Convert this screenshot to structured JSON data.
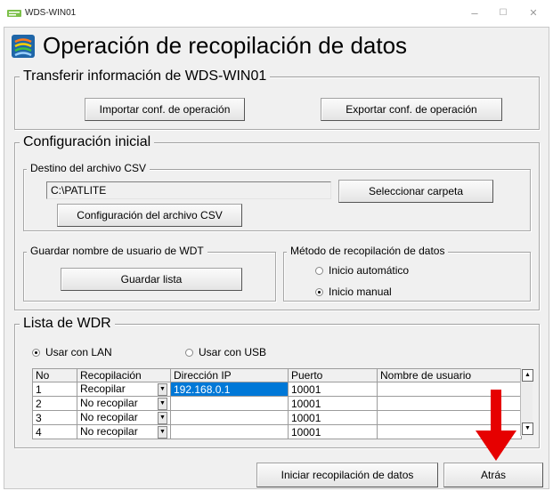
{
  "window": {
    "title": "WDS-WIN01",
    "minimize": "–",
    "maximize": "☐",
    "close": "✕"
  },
  "header": {
    "title": "Operación de recopilación de datos"
  },
  "transfer": {
    "label": "Transferir información de WDS-WIN01",
    "import_button": "Importar conf. de operación",
    "export_button": "Exportar conf. de operación"
  },
  "initial_config": {
    "label": "Configuración inicial",
    "csv_destination": {
      "label": "Destino del archivo CSV",
      "path_value": "C:\\PATLITE",
      "select_folder_button": "Seleccionar carpeta",
      "csv_config_button": "Configuración del archivo CSV"
    },
    "save_username": {
      "label": "Guardar nombre de usuario de WDT",
      "save_list_button": "Guardar lista"
    },
    "method": {
      "label": "Método de recopilación de datos",
      "options": [
        {
          "label": "Inicio automático",
          "selected": false
        },
        {
          "label": "Inicio manual",
          "selected": true
        }
      ]
    }
  },
  "wdr_list": {
    "label": "Lista de WDR",
    "connection": [
      {
        "label": "Usar con LAN",
        "selected": true
      },
      {
        "label": "Usar con USB",
        "selected": false
      }
    ],
    "columns": [
      "No",
      "Recopilación",
      "Dirección IP",
      "Puerto",
      "Nombre de usuario"
    ],
    "rows": [
      {
        "no": "1",
        "collection": "Recopilar",
        "ip": "192.168.0.1",
        "port": "10001",
        "user": ""
      },
      {
        "no": "2",
        "collection": "No recopilar",
        "ip": "",
        "port": "10001",
        "user": ""
      },
      {
        "no": "3",
        "collection": "No recopilar",
        "ip": "",
        "port": "10001",
        "user": ""
      },
      {
        "no": "4",
        "collection": "No recopilar",
        "ip": "",
        "port": "10001",
        "user": ""
      }
    ]
  },
  "footer": {
    "start_button": "Iniciar recopilación de datos",
    "back_button": "Atrás"
  },
  "colors": {
    "selection": "#0078d7",
    "annotation_arrow": "#e60000"
  },
  "icons": {
    "app": "app-icon",
    "header": "data-collection-icon",
    "arrow": "red-down-arrow"
  }
}
